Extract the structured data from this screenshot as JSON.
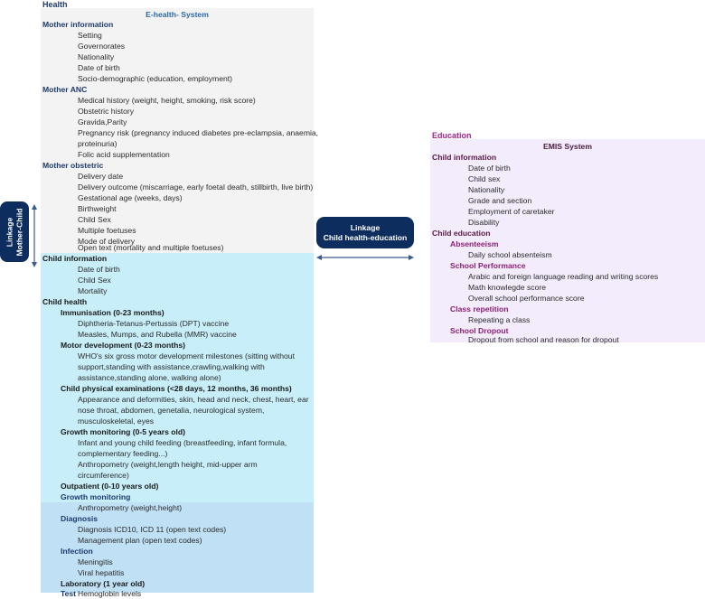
{
  "health": {
    "section_label": "Health",
    "system_title": "E-health- System",
    "mother_information": {
      "heading": "Mother information",
      "items": [
        "Setting",
        "Governorates",
        "Nationality",
        "Date of birth",
        "Socio-demographic (education, employment)"
      ]
    },
    "mother_anc": {
      "heading": "Mother ANC",
      "items": [
        "Medical history (weight, height, smoking, risk score)",
        "Obstetric history",
        "Gravida,Parity",
        "Pregnancy risk (pregnancy induced diabetes pre-eclampsia, anaemia,",
        "proteinuria)",
        "Folic acid supplementation"
      ]
    },
    "mother_obstetric": {
      "heading": "Mother obstetric",
      "items": [
        "Delivery date",
        "Delivery outcome (miscarriage, early foetal death, stillbirth, live birth)",
        "Gestational age (weeks, days)",
        "Birthweight",
        "Child Sex",
        "Multiple foetuses",
        "Mode of delivery",
        "Open text (mortality and multiple foetuses)"
      ]
    },
    "child_information": {
      "heading": "Child information",
      "items": [
        "Date of birth",
        "Child Sex",
        "Mortality"
      ]
    },
    "child_health": {
      "heading": "Child health",
      "immunisation": {
        "heading": "Immunisation (0-23 months)",
        "items": [
          "Diphtheria-Tetanus-Pertussis (DPT) vaccine",
          "Measles, Mumps, and Rubella (MMR) vaccine"
        ]
      },
      "motor": {
        "heading": "Motor development (0-23 months)",
        "items": [
          "WHO's six gross motor development milestones (sitting without",
          "support,standing with assistance,crawling,walking with",
          "assistance,standing alone, walking alone)"
        ]
      },
      "physical": {
        "heading": "Child physical examinations (<28 days, 12 months, 36 months)",
        "items": [
          "Appearance and deformities, skin, head and neck, chest, heart, ear",
          "nose throat, abdomen, genetalia, neurological system,",
          "musculoskeletal, eyes"
        ]
      },
      "growth": {
        "heading": "Growth monitoring (0-5 years old)",
        "items": [
          "Infant and young child feeding (breastfeeding, infant formula,",
          "complementary feeding...)",
          "Anthropometry (weight,length height, mid-upper arm",
          "circumference)"
        ]
      }
    },
    "outpatient": {
      "heading": "Outpatient (0-10 years old)",
      "growth_heading": "Growth monitoring",
      "growth_items": [
        "Anthropometry (weight,height)"
      ],
      "diagnosis_heading": "Diagnosis",
      "diagnosis_items": [
        "Diagnosis ICD10, ICD 11 (open text codes)",
        "Management plan (open text codes)"
      ],
      "infection_heading": "Infection",
      "infection_items": [
        "Meningitis",
        "Viral hepatitis"
      ],
      "lab_heading": "Laboratory (1 year old)",
      "test_label": "Test",
      "test_item": "Hemoglobin levels"
    }
  },
  "education": {
    "section_label": "Education",
    "system_title": "EMIS System",
    "child_information": {
      "heading": "Child information",
      "items": [
        "Date of birth",
        "Child sex",
        "Nationality",
        "Grade and section",
        "Employment of caretaker",
        "Disability"
      ]
    },
    "child_education": {
      "heading": "Child education",
      "absenteeism": {
        "heading": "Absenteeism",
        "items": [
          "Daily school absenteism"
        ]
      },
      "performance": {
        "heading": "School Performance",
        "items": [
          "Arabic and foreign language reading and writing scores",
          "Math knowlegde score",
          "Overall school performance score"
        ]
      },
      "repetition": {
        "heading": "Class repetition",
        "items": [
          "Repeating a class"
        ]
      },
      "dropout": {
        "heading": "School Dropout",
        "items": [
          "Dropout from school and reason for dropout"
        ]
      }
    }
  },
  "linkages": {
    "mother_child": {
      "line1": "Linkage",
      "line2": "Mother-Child"
    },
    "child_health_education": {
      "line1": "Linkage",
      "line2": "Child health-education"
    }
  },
  "colors": {
    "badge": "#0d2d5e",
    "mother_panel": "#f3f3f3",
    "child_panel": "#c7eef9",
    "outpatient_panel": "#bfe0f5",
    "education_panel": "#f3ecfc",
    "health_heading": "#1f3a6e",
    "education_heading": "#a0268f"
  }
}
